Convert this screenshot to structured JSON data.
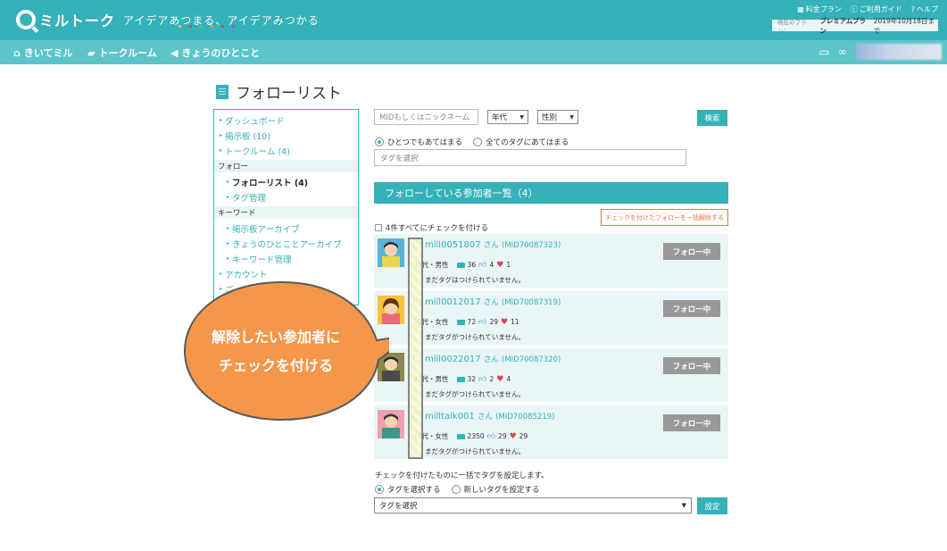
{
  "header": {
    "logo": "ミルトーク",
    "tagline": "アイデアあつまる、アイデアみつかる",
    "tagline_dot_colors": [
      "#f2c94c",
      "#e04050",
      "#7bc043",
      "#f2994a",
      "#e04050",
      "#9b51e0"
    ],
    "links": {
      "pricing": "料金プラン",
      "guide": "ご利用ガイド",
      "help": "ヘルプ"
    },
    "plan_label": "現在のプラン：",
    "plan_name": "プレミアムプラン",
    "plan_until": "2019年10月18日まで"
  },
  "nav": {
    "items": [
      "きいてミル",
      "トークルーム",
      "きょうのひとこと"
    ]
  },
  "page": {
    "title": "フォローリスト"
  },
  "sidebar": {
    "links_top": [
      "ダッシュボード",
      "掲示板 (10)",
      "トークルーム (4)"
    ],
    "section_follow": "フォロー",
    "follow_links": [
      "フォローリスト (4)",
      "タグ管理"
    ],
    "section_keyword": "キーワード",
    "keyword_links": [
      "掲示板アーカイブ",
      "きょうのひとことアーカイブ",
      "キーワード管理"
    ],
    "links_bottom": [
      "アカウント",
      "ご"
    ]
  },
  "filter": {
    "mid_placeholder": "MIDもしくはニックネーム",
    "age_select": "年代",
    "gender_select": "性別",
    "search_button": "検索",
    "radio_any": "ひとつでもあてはまる",
    "radio_all": "全てのタグにあてはまる",
    "tag_placeholder": "タグを選択"
  },
  "list": {
    "header": "フォローしている参加者一覧（4）",
    "unfollow_all": "チェックを付けたフォローを一括解除する",
    "check_all": "4件すべてにチェックを付ける",
    "san": "さん",
    "follow_button": "フォロー中",
    "rows": [
      {
        "name": "mill0051807",
        "mid": "(MID70087323)",
        "age": "30代・男性",
        "chat": "36",
        "thumb": "4",
        "heart": "1",
        "tags": "まだタグはつけられていません。"
      },
      {
        "name": "mill0012017",
        "mid": "(MID70087319)",
        "age": "20代・女性",
        "chat": "72",
        "thumb": "29",
        "heart": "11",
        "tags": "まだタグがつけられていません。"
      },
      {
        "name": "mill0022017",
        "mid": "(MID70087320)",
        "age": "30代・男性",
        "chat": "32",
        "thumb": "2",
        "heart": "4",
        "tags": "まだタグがつけられていません。"
      },
      {
        "name": "milltalk001",
        "mid": "(MID70085219)",
        "age": "10代・女性",
        "chat": "2350",
        "thumb": "29",
        "heart": "29",
        "tags": "まだタグがつけられていません。"
      }
    ]
  },
  "bottom": {
    "instruction": "チェックを付けたものに一括でタグを設定します。",
    "radio_select": "タグを選択する",
    "radio_new": "新しいタグを設定する",
    "tag_select": "タグを選択",
    "set_button": "設定"
  },
  "callout": {
    "line1": "解除したい参加者に",
    "line2": "チェックを付ける",
    "color": "#f5974a"
  }
}
